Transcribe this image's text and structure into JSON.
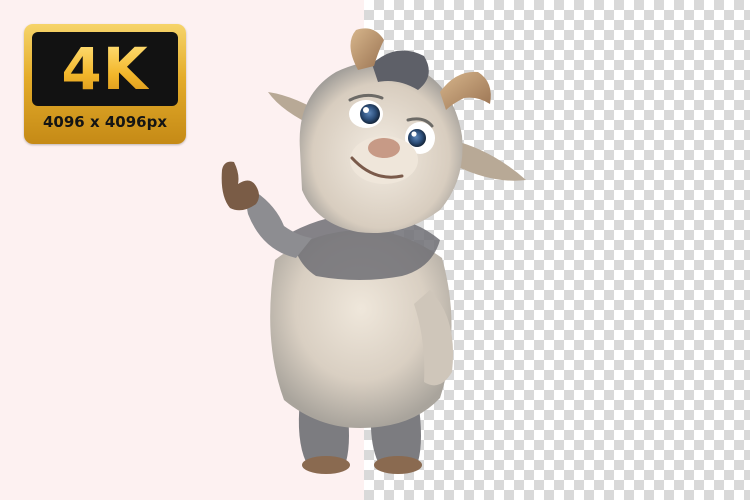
{
  "badge": {
    "main_text": "4K",
    "resolution_text": "4096 x 4096px"
  },
  "colors": {
    "left_background": "#fdf1f1",
    "checker_light": "#ffffff",
    "checker_dark": "#d9d9d9",
    "badge_gold": "#e4ac2a",
    "badge_dark": "#121212"
  },
  "illustration": {
    "subject": "cartoon fluffy goat waving",
    "icons": [
      "goat-illustration"
    ]
  }
}
